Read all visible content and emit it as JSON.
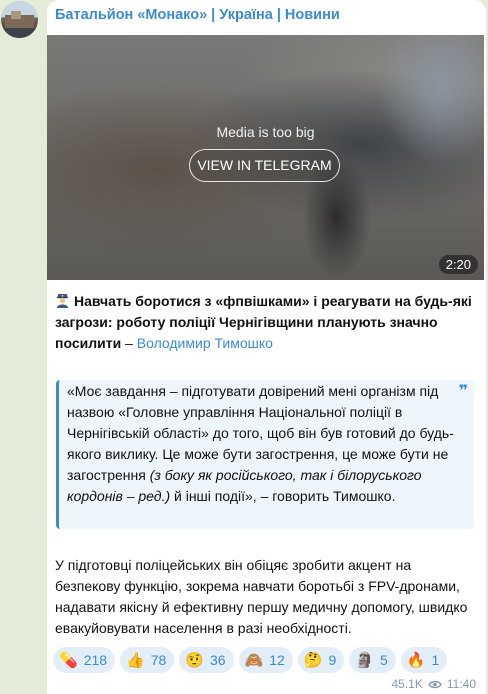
{
  "channel": {
    "title": "Батальйон «Монако» | Україна | Новини"
  },
  "media": {
    "label": "Media is too big",
    "button": "VIEW IN TELEGRAM",
    "duration": "2:20"
  },
  "post": {
    "headline": "Навчать боротися з «фпвішками» і реагувати на будь-які загрози: роботу поліції Чернігівщини планують значно посилити",
    "dash": " – ",
    "author": "Володимир Тимошко",
    "quote_part1": "«Моє завдання – підготувати довірений мені організм під назвою «Головне управління Національної поліції в Чернігівській області» до того, щоб він був готовий до будь-якого виклику. Це може бути загострення, це може бути не загострення ",
    "quote_italic": "(з боку як російського, так і білоруського кордонів – ред.)",
    "quote_part2": " й інші події», – говорить Тимошко.",
    "paragraph": "У підготовці поліцейських він обіцяє зробити акцент на безпекову функцію, зокрема навчати боротьбі з FPV-дронами, надавати якісну й ефективну першу медичну допомогу, швидко евакуйовувати населення в разі необхідності."
  },
  "reactions": [
    {
      "emoji": "💊",
      "count": "218"
    },
    {
      "emoji": "👍",
      "count": "78"
    },
    {
      "emoji": "🤨",
      "count": "36"
    },
    {
      "emoji": "🙈",
      "count": "12"
    },
    {
      "emoji": "🤔",
      "count": "9"
    },
    {
      "emoji": "🗿",
      "count": "5"
    },
    {
      "emoji": "🔥",
      "count": "1"
    }
  ],
  "meta": {
    "views": "45.1K",
    "time": "11:40"
  },
  "colors": {
    "accent": "#3a8bd0",
    "background": "#e4ebd6",
    "quote_bg": "#eef5fc"
  }
}
